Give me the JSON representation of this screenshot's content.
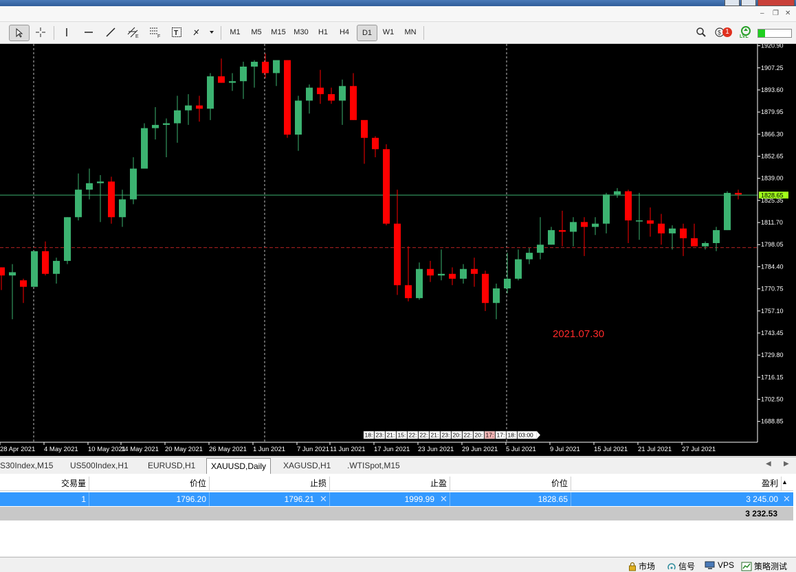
{
  "toolbar": {
    "timeframes": [
      {
        "label": "M1",
        "active": false
      },
      {
        "label": "M5",
        "active": false
      },
      {
        "label": "M15",
        "active": false
      },
      {
        "label": "M30",
        "active": false
      },
      {
        "label": "H1",
        "active": false
      },
      {
        "label": "H4",
        "active": false
      },
      {
        "label": "D1",
        "active": true
      },
      {
        "label": "W1",
        "active": false
      },
      {
        "label": "MN",
        "active": false
      }
    ],
    "notification_count": "1",
    "lvl_label": "LVL"
  },
  "chart_data": {
    "type": "candlestick",
    "symbol_timeframe": "XAUUSD,Daily",
    "annotation": "2021.07.30",
    "current_price_label": "1828.65",
    "current_price": 1828.65,
    "reference_line": 1796.2,
    "ylim": [
      1676.0,
      1922.0
    ],
    "y_ticks": [
      "1920.90",
      "1907.25",
      "1893.60",
      "1879.95",
      "1866.30",
      "1852.65",
      "1839.00",
      "1825.35",
      "1811.70",
      "1798.05",
      "1784.40",
      "1770.75",
      "1757.10",
      "1743.45",
      "1729.80",
      "1716.15",
      "1702.50",
      "1688.85"
    ],
    "x_tick_labels": [
      "28 Apr 2021",
      "4 May 2021",
      "10 May 2021",
      "14 May 2021",
      "20 May 2021",
      "26 May 2021",
      "1 Jun 2021",
      "7 Jun 2021",
      "11 Jun 2021",
      "17 Jun 2021",
      "23 Jun 2021",
      "29 Jun 2021",
      "5 Jul 2021",
      "9 Jul 2021",
      "15 Jul 2021",
      "21 Jul 2021",
      "27 Jul 2021"
    ],
    "time_markers": [
      "18:",
      "23:",
      "21:",
      "15:",
      "22:",
      "22:",
      "21:",
      "23:",
      "20:",
      "22:",
      "20:",
      "17:",
      "17:",
      "18:",
      "03:00"
    ],
    "candles": [
      [
        1784,
        1784,
        1770,
        1779
      ],
      [
        1779,
        1786,
        1752,
        1781
      ],
      [
        1776,
        1777,
        1762,
        1772
      ],
      [
        1772,
        1794,
        1772,
        1794
      ],
      [
        1794,
        1800,
        1779,
        1780
      ],
      [
        1780,
        1790,
        1774,
        1788
      ],
      [
        1788,
        1815,
        1786,
        1815
      ],
      [
        1815,
        1842,
        1813,
        1832
      ],
      [
        1832,
        1845,
        1826,
        1836
      ],
      [
        1836,
        1841,
        1812,
        1837
      ],
      [
        1837,
        1840,
        1811,
        1815
      ],
      [
        1815,
        1832,
        1809,
        1826
      ],
      [
        1826,
        1852,
        1823,
        1845
      ],
      [
        1845,
        1873,
        1845,
        1870
      ],
      [
        1870,
        1883,
        1863,
        1872
      ],
      [
        1872,
        1876,
        1852,
        1873
      ],
      [
        1873,
        1890,
        1861,
        1881
      ],
      [
        1881,
        1891,
        1872,
        1884
      ],
      [
        1884,
        1890,
        1874,
        1882
      ],
      [
        1882,
        1904,
        1875,
        1902
      ],
      [
        1902,
        1913,
        1898,
        1898
      ],
      [
        1898,
        1904,
        1893,
        1899
      ],
      [
        1899,
        1911,
        1888,
        1908
      ],
      [
        1908,
        1912,
        1895,
        1911
      ],
      [
        1911,
        1916,
        1901,
        1904
      ],
      [
        1904,
        1911,
        1896,
        1912
      ],
      [
        1912,
        1912,
        1864,
        1866
      ],
      [
        1866,
        1890,
        1856,
        1887
      ],
      [
        1887,
        1897,
        1879,
        1895
      ],
      [
        1895,
        1906,
        1885,
        1891
      ],
      [
        1891,
        1895,
        1885,
        1887
      ],
      [
        1887,
        1900,
        1872,
        1896
      ],
      [
        1896,
        1904,
        1875,
        1875
      ],
      [
        1875,
        1874,
        1848,
        1864
      ],
      [
        1864,
        1865,
        1852,
        1857
      ],
      [
        1857,
        1860,
        1810,
        1811
      ],
      [
        1811,
        1832,
        1767,
        1773
      ],
      [
        1773,
        1797,
        1763,
        1765
      ],
      [
        1765,
        1787,
        1764,
        1783
      ],
      [
        1783,
        1788,
        1775,
        1779
      ],
      [
        1779,
        1795,
        1776,
        1780
      ],
      [
        1780,
        1784,
        1773,
        1777
      ],
      [
        1777,
        1786,
        1774,
        1783
      ],
      [
        1783,
        1790,
        1772,
        1780
      ],
      [
        1780,
        1782,
        1757,
        1762
      ],
      [
        1762,
        1774,
        1752,
        1771
      ],
      [
        1771,
        1793,
        1768,
        1777
      ],
      [
        1777,
        1795,
        1776,
        1789
      ],
      [
        1789,
        1796,
        1786,
        1793
      ],
      [
        1793,
        1815,
        1789,
        1798
      ],
      [
        1798,
        1809,
        1798,
        1807
      ],
      [
        1807,
        1819,
        1797,
        1806
      ],
      [
        1806,
        1815,
        1797,
        1812
      ],
      [
        1812,
        1815,
        1791,
        1809
      ],
      [
        1809,
        1815,
        1804,
        1811
      ],
      [
        1811,
        1830,
        1805,
        1829
      ],
      [
        1829,
        1833,
        1827,
        1831
      ],
      [
        1831,
        1832,
        1799,
        1813
      ],
      [
        1813,
        1830,
        1801,
        1813
      ],
      [
        1813,
        1821,
        1803,
        1811
      ],
      [
        1811,
        1817,
        1798,
        1805
      ],
      [
        1805,
        1810,
        1795,
        1808
      ],
      [
        1808,
        1811,
        1791,
        1802
      ],
      [
        1802,
        1811,
        1797,
        1797
      ],
      [
        1797,
        1800,
        1795,
        1799
      ],
      [
        1799,
        1809,
        1794,
        1807
      ],
      [
        1807,
        1831,
        1807,
        1830
      ],
      [
        1830,
        1832,
        1826,
        1829
      ]
    ],
    "colors": {
      "bull": "#3cb371",
      "bear": "#ff0000",
      "background": "#000000",
      "axis_text": "#ffffff",
      "annotation": "#ff2a2a",
      "price_line": "#3cb371",
      "reference_line": "#b22222",
      "price_label_bg": "#a0ff1a"
    }
  },
  "tabs": [
    {
      "label": "S30Index,M15",
      "active": false
    },
    {
      "label": "US500Index,H1",
      "active": false
    },
    {
      "label": "EURUSD,H1",
      "active": false
    },
    {
      "label": "XAUUSD,Daily",
      "active": true
    },
    {
      "label": "XAGUSD,H1",
      "active": false
    },
    {
      "label": ".WTISpot,M15",
      "active": false
    }
  ],
  "table": {
    "headers": [
      "交易量",
      "价位",
      "止损",
      "止盈",
      "价位",
      "盈利"
    ],
    "row": {
      "volume": "1",
      "open_price": "1796.20",
      "stop_loss": "1796.21",
      "take_profit": "1999.99",
      "current_price": "1828.65",
      "profit": "3 245.00"
    },
    "total": "3 232.53"
  },
  "statusbar": [
    {
      "label": "市场",
      "icon": "lock-icon"
    },
    {
      "label": "信号",
      "icon": "signal-icon"
    },
    {
      "label": "VPS",
      "icon": "vps-icon"
    },
    {
      "label": "策略测试",
      "icon": "tester-icon"
    }
  ]
}
